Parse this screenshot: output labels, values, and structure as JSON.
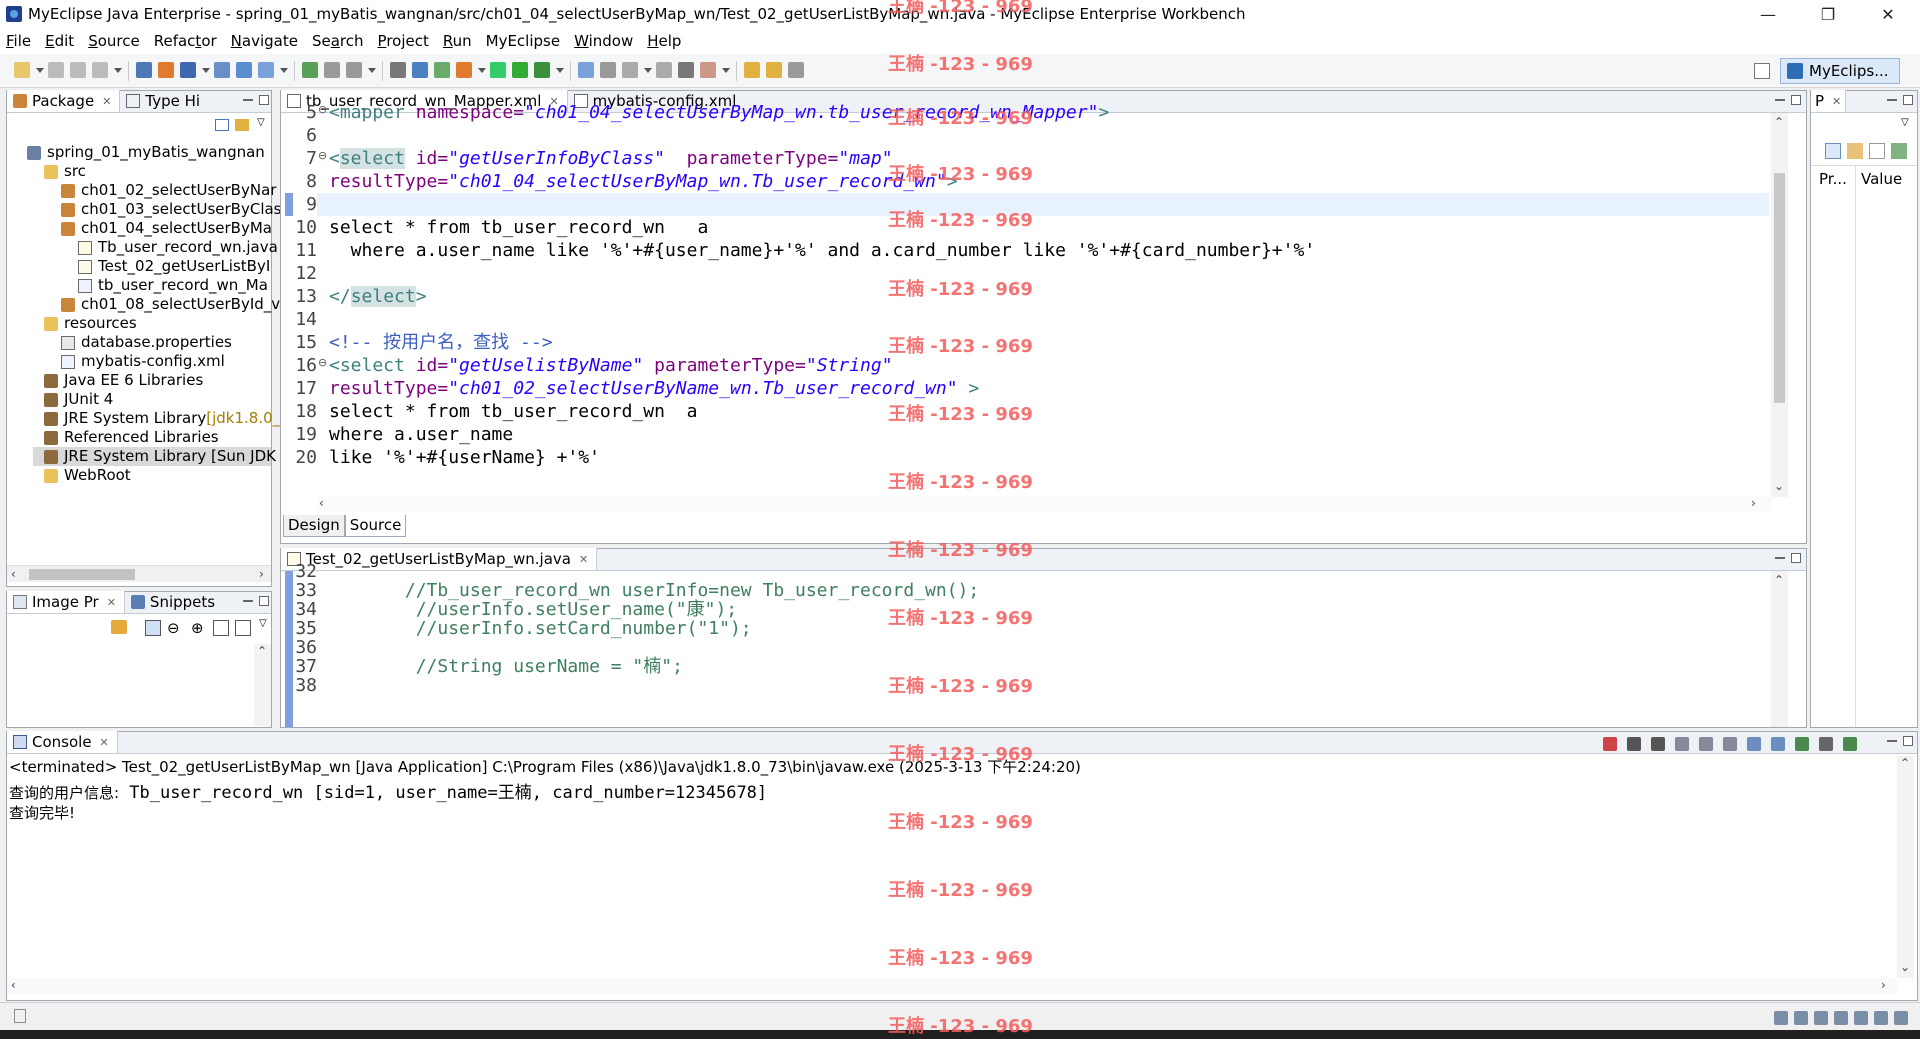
{
  "window": {
    "title": "MyEclipse Java Enterprise - spring_01_myBatis_wangnan/src/ch01_04_selectUserByMap_wn/Test_02_getUserListByMap_wn.java - MyEclipse Enterprise Workbench",
    "minimize": "—",
    "restore": "❐",
    "close": "✕"
  },
  "menu": [
    {
      "u": "F",
      "rest": "ile"
    },
    {
      "u": "E",
      "rest": "dit"
    },
    {
      "u": "S",
      "rest": "ource"
    },
    {
      "pre": "Refac",
      "u": "t",
      "rest": "or"
    },
    {
      "u": "N",
      "rest": "avigate"
    },
    {
      "pre": "Se",
      "u": "a",
      "rest": "rch"
    },
    {
      "u": "P",
      "rest": "roject"
    },
    {
      "u": "R",
      "rest": "un"
    },
    {
      "pre": "MyEclipse",
      "u": "",
      "rest": ""
    },
    {
      "u": "W",
      "rest": "indow"
    },
    {
      "u": "H",
      "rest": "elp"
    }
  ],
  "perspective": {
    "label": "MyEclips..."
  },
  "package_explorer": {
    "tab1": "Package",
    "tab2": "Type Hi",
    "tree": [
      {
        "label": "spring_01_myBatis_wangnan",
        "icon": "project-icon",
        "indent": 0
      },
      {
        "label": "src",
        "icon": "source-folder-icon",
        "indent": 1
      },
      {
        "label": "ch01_02_selectUserByNar",
        "icon": "package-icon",
        "indent": 2
      },
      {
        "label": "ch01_03_selectUserByClas",
        "icon": "package-icon",
        "indent": 2
      },
      {
        "label": "ch01_04_selectUserByMa",
        "icon": "package-icon",
        "indent": 2
      },
      {
        "label": "Tb_user_record_wn.java",
        "icon": "java-file-icon",
        "indent": 3
      },
      {
        "label": "Test_02_getUserListByI",
        "icon": "java-file-icon",
        "indent": 3
      },
      {
        "label": "tb_user_record_wn_Ma",
        "icon": "xml-file-icon",
        "indent": 3
      },
      {
        "label": "ch01_08_selectUserById_v",
        "icon": "package-icon",
        "indent": 2
      },
      {
        "label": "resources",
        "icon": "source-folder-icon",
        "indent": 1
      },
      {
        "label": "database.properties",
        "icon": "properties-file-icon",
        "indent": 2
      },
      {
        "label": "mybatis-config.xml",
        "icon": "xml-file-icon",
        "indent": 2
      },
      {
        "label": "Java EE 6 Libraries",
        "icon": "library-icon",
        "indent": 1
      },
      {
        "label": "JUnit 4",
        "icon": "library-icon",
        "indent": 1
      },
      {
        "label": "JRE System Library",
        "suffix": " [jdk1.8.0_",
        "icon": "library-icon",
        "indent": 1
      },
      {
        "label": "Referenced Libraries",
        "icon": "library-icon",
        "indent": 1
      },
      {
        "label": "JRE System Library [Sun JDK",
        "icon": "library-icon",
        "indent": 1,
        "selected": true
      },
      {
        "label": "WebRoot",
        "icon": "folder-icon",
        "indent": 1
      }
    ]
  },
  "image_preview": {
    "tab1": "Image Pr",
    "tab2": "Snippets"
  },
  "editor_top": {
    "tabs": [
      "tb_user_record_wn_Mapper.xml",
      "mybatis-config.xml"
    ],
    "design_tab": "Design",
    "source_tab": "Source",
    "lines": [
      {
        "n": "5",
        "fold": "⊖",
        "html": [
          [
            "k-tag",
            "<mapper "
          ],
          [
            "k-attr",
            "namespace="
          ],
          [
            "k-str",
            "\"ch01_04_selectUserByMap_wn.tb_user_record_wn_Mapper\""
          ],
          [
            "k-tag",
            ">"
          ]
        ]
      },
      {
        "n": "6",
        "html": []
      },
      {
        "n": "7",
        "fold": "⊖",
        "html": [
          [
            "k-tag",
            "<"
          ],
          [
            "k-tag k-hl",
            "select"
          ],
          [
            "k-tag",
            " "
          ],
          [
            "k-attr",
            "id="
          ],
          [
            "k-str",
            "\"getUserInfoByClass\""
          ],
          [
            "k-sql",
            "  "
          ],
          [
            "k-attr",
            "parameterType="
          ],
          [
            "k-str",
            "\"map\""
          ]
        ]
      },
      {
        "n": "8",
        "html": [
          [
            "k-attr",
            "resultType="
          ],
          [
            "k-str",
            "\"ch01_04_selectUserByMap_wn.Tb_user_record_wn\""
          ],
          [
            "k-tag",
            ">"
          ]
        ]
      },
      {
        "n": "9",
        "html": []
      },
      {
        "n": "10",
        "html": [
          [
            "k-sql",
            "select * from tb_user_record_wn   a"
          ]
        ]
      },
      {
        "n": "11",
        "html": [
          [
            "k-sql",
            "  where a.user_name like '%'+#{user_name}+'%' and a.card_number like '%'+#{card_number}+'%'"
          ]
        ]
      },
      {
        "n": "12",
        "html": []
      },
      {
        "n": "13",
        "html": [
          [
            "k-tag",
            "</"
          ],
          [
            "k-tag k-hl",
            "select"
          ],
          [
            "k-tag",
            ">"
          ]
        ]
      },
      {
        "n": "14",
        "html": []
      },
      {
        "n": "15",
        "html": [
          [
            "k-com",
            "<!-- 按用户名，查找 -->"
          ]
        ]
      },
      {
        "n": "16",
        "fold": "⊖",
        "html": [
          [
            "k-tag",
            "<select "
          ],
          [
            "k-attr",
            "id="
          ],
          [
            "k-str",
            "\"getUselistByName\""
          ],
          [
            "k-sql",
            " "
          ],
          [
            "k-attr",
            "parameterType="
          ],
          [
            "k-str",
            "\"String\""
          ]
        ]
      },
      {
        "n": "17",
        "html": [
          [
            "k-attr",
            "resultType="
          ],
          [
            "k-str",
            "\"ch01_02_selectUserByName_wn.Tb_user_record_wn\""
          ],
          [
            "k-tag",
            " >"
          ]
        ]
      },
      {
        "n": "18",
        "html": [
          [
            "k-sql",
            "select * from tb_user_record_wn  a"
          ]
        ]
      },
      {
        "n": "19",
        "html": [
          [
            "k-sql",
            "where a.user_name"
          ]
        ]
      },
      {
        "n": "20",
        "html": [
          [
            "k-sql",
            "like '%'+#{userName} +'%'"
          ]
        ]
      }
    ]
  },
  "editor_bottom": {
    "tab": "Test_02_getUserListByMap_wn.java",
    "lines": [
      {
        "n": "32",
        "text": ""
      },
      {
        "n": "33",
        "text": "       //Tb_user_record_wn userInfo=new Tb_user_record_wn();"
      },
      {
        "n": "34",
        "text": "        //userInfo.setUser_name(\"康\");"
      },
      {
        "n": "35",
        "text": "        //userInfo.setCard_number(\"1\");"
      },
      {
        "n": "36",
        "text": ""
      },
      {
        "n": "37",
        "text": "        //String userName = \"楠\";"
      },
      {
        "n": "38",
        "text": ""
      }
    ]
  },
  "properties": {
    "tab": "P",
    "col1": "Pr...",
    "col2": "Value"
  },
  "console": {
    "tab": "Console",
    "status": "<terminated> Test_02_getUserListByMap_wn [Java Application] C:\\Program Files (x86)\\Java\\jdk1.8.0_73\\bin\\javaw.exe (2025-3-13 下午2:24:20)",
    "output_label": "查询的用户信息:",
    "output_value": " Tb_user_record_wn [sid=1, user_name=王楠, card_number=12345678]",
    "done": "查询完毕!"
  },
  "watermark": "王楠 -123 - 969"
}
